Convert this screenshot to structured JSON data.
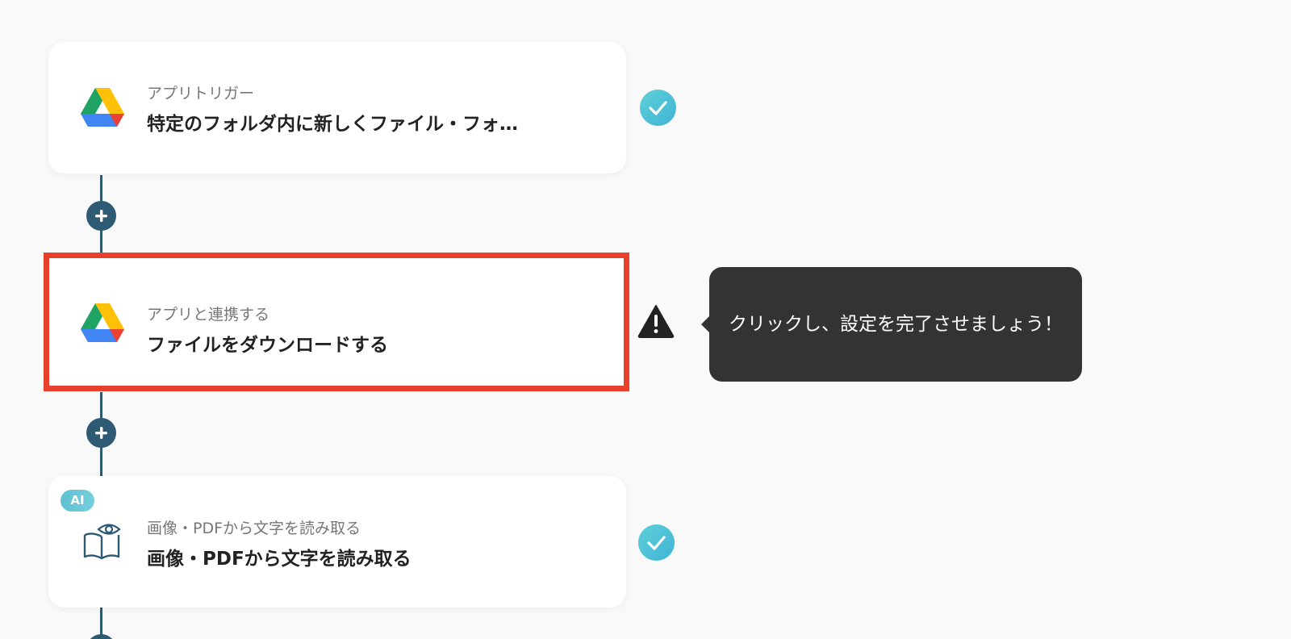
{
  "steps": [
    {
      "label": "アプリトリガー",
      "title": "特定のフォルダ内に新しくファイル・フォ…",
      "icon": "google-drive-icon",
      "status": "complete"
    },
    {
      "label": "アプリと連携する",
      "title": "ファイルをダウンロードする",
      "icon": "google-drive-icon",
      "status": "warning"
    },
    {
      "label": "画像・PDFから文字を読み取る",
      "title": "画像・PDFから文字を読み取る",
      "icon": "book-eye-icon",
      "status": "complete",
      "badge": "AI"
    }
  ],
  "tooltip": {
    "text": "クリックし、設定を完了させましょう！"
  },
  "colors": {
    "connector": "#2e5a74",
    "highlight_border": "#e8402a",
    "check": "#4cc3d6",
    "tooltip_bg": "#333333"
  }
}
